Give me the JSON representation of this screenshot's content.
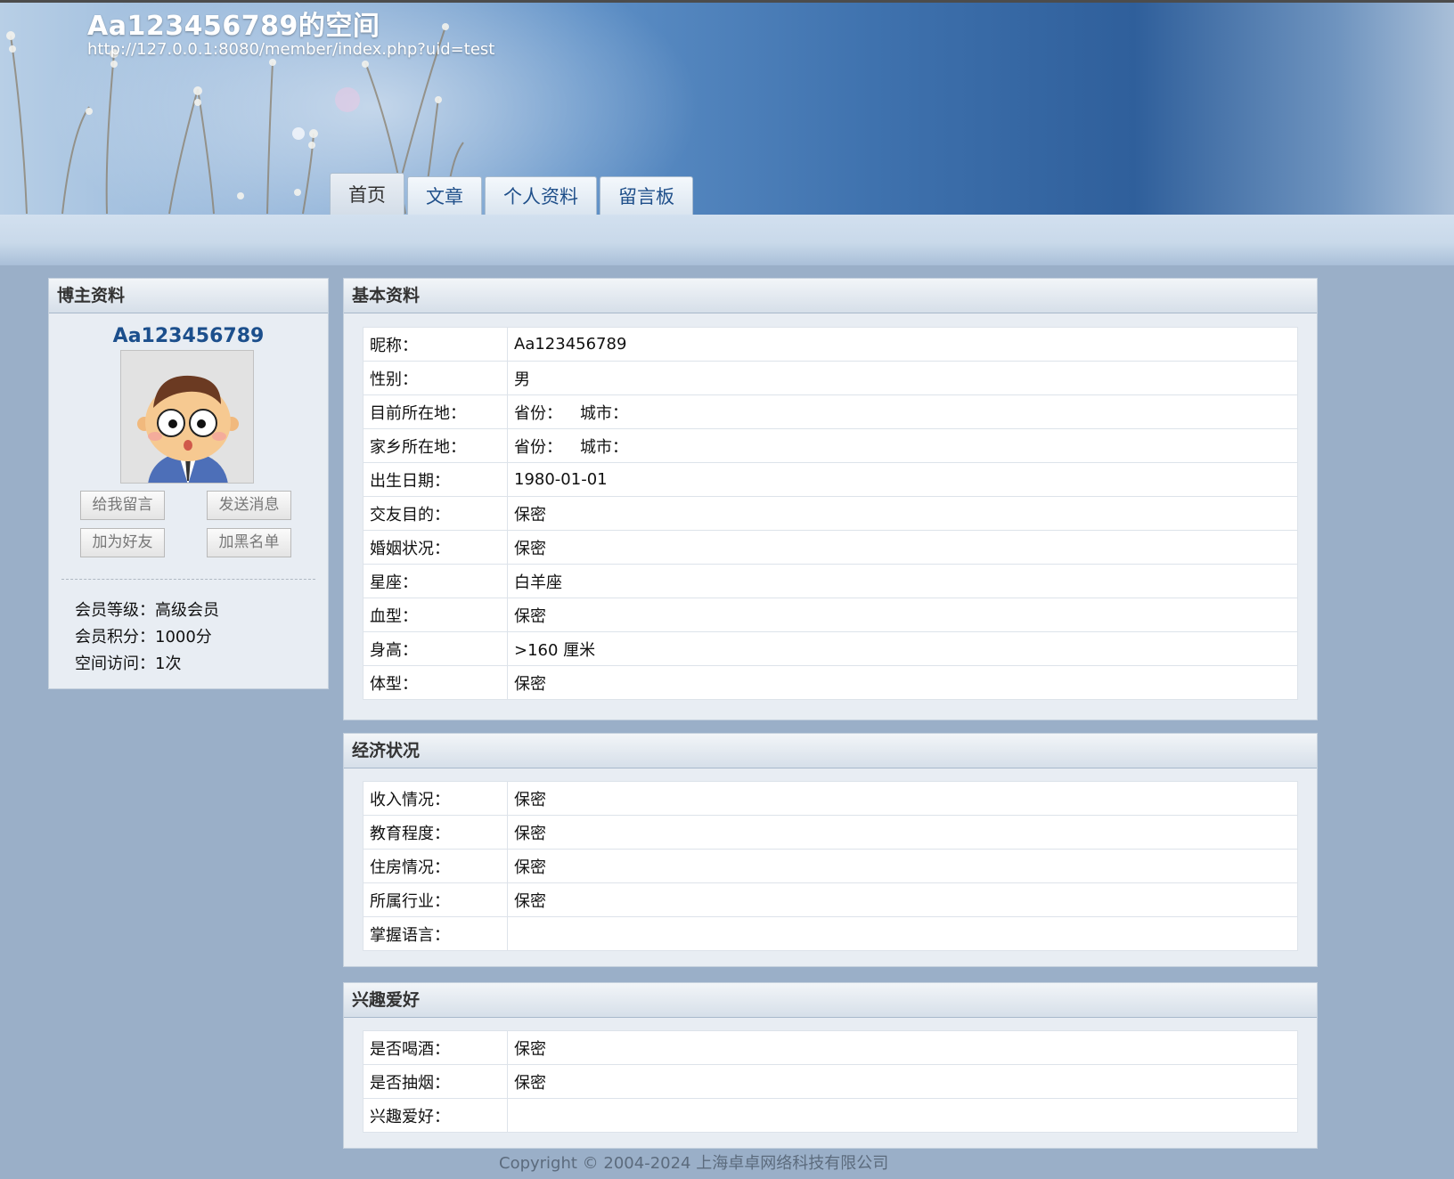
{
  "header": {
    "title": "Aa123456789的空间",
    "url": "http://127.0.0.1:8080/member/index.php?uid=test"
  },
  "tabs": [
    {
      "label": "首页",
      "active": true
    },
    {
      "label": "文章",
      "active": false
    },
    {
      "label": "个人资料",
      "active": false
    },
    {
      "label": "留言板",
      "active": false
    }
  ],
  "blogger": {
    "heading": "博主资料",
    "name": "Aa123456789",
    "buttons": {
      "leave_message": "给我留言",
      "send_message": "发送消息",
      "add_friend": "加为好友",
      "blacklist": "加黑名单"
    },
    "stats": {
      "level": "会员等级：高级会员",
      "points": "会员积分：1000分",
      "visits": "空间访问：1次"
    }
  },
  "basic": {
    "heading": "基本资料",
    "rows": [
      {
        "label": "昵称：",
        "value": "Aa123456789"
      },
      {
        "label": "性别：",
        "value": "男"
      },
      {
        "label": "目前所在地：",
        "province": "省份：",
        "city": "城市："
      },
      {
        "label": "家乡所在地：",
        "province": "省份：",
        "city": "城市："
      },
      {
        "label": "出生日期：",
        "value": "1980-01-01"
      },
      {
        "label": "交友目的：",
        "value": "保密"
      },
      {
        "label": "婚姻状况：",
        "value": "保密"
      },
      {
        "label": "星座：",
        "value": "白羊座"
      },
      {
        "label": "血型：",
        "value": "保密"
      },
      {
        "label": "身高：",
        "value": ">160 厘米"
      },
      {
        "label": "体型：",
        "value": "保密"
      }
    ]
  },
  "economy": {
    "heading": "经济状况",
    "rows": [
      {
        "label": "收入情况：",
        "value": "保密"
      },
      {
        "label": "教育程度：",
        "value": "保密"
      },
      {
        "label": "住房情况：",
        "value": "保密"
      },
      {
        "label": "所属行业：",
        "value": "保密"
      },
      {
        "label": "掌握语言：",
        "value": ""
      }
    ]
  },
  "hobbies": {
    "heading": "兴趣爱好",
    "rows": [
      {
        "label": "是否喝酒：",
        "value": "保密"
      },
      {
        "label": "是否抽烟：",
        "value": "保密"
      },
      {
        "label": "兴趣爱好：",
        "value": ""
      }
    ]
  },
  "footer": {
    "copyright": "Copyright © 2004-2024 上海卓卓网络科技有限公司"
  },
  "colors": {
    "page_bg": "#9aafc8",
    "panel_bg": "#e8edf3",
    "name_blue": "#1c4f8c",
    "tab_text": "#1f4f8a"
  }
}
